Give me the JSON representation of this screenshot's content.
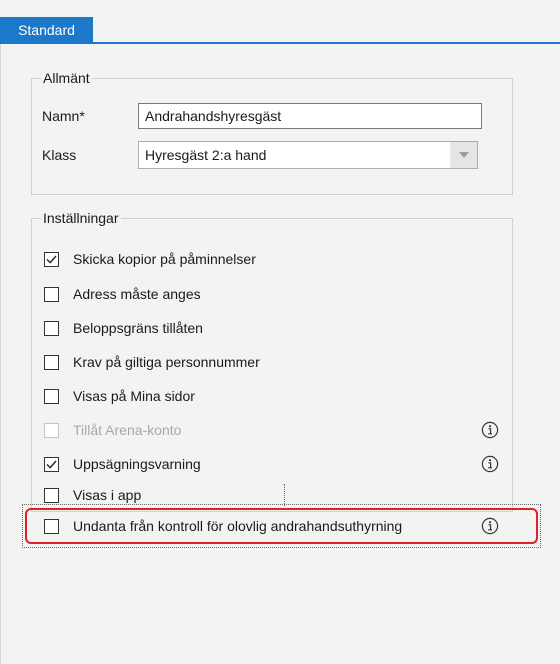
{
  "tabs": [
    {
      "label": "Standard"
    }
  ],
  "general": {
    "legend": "Allmänt",
    "name_label": "Namn*",
    "name_value": "Andrahandshyresgäst",
    "class_label": "Klass",
    "class_value": "Hyresgäst 2:a hand"
  },
  "settings": {
    "legend": "Inställningar",
    "items": [
      {
        "label": "Skicka kopior på påminnelser",
        "checked": true,
        "enabled": true,
        "info": false
      },
      {
        "label": "Adress måste anges",
        "checked": false,
        "enabled": true,
        "info": false
      },
      {
        "label": "Beloppsgräns tillåten",
        "checked": false,
        "enabled": true,
        "info": false
      },
      {
        "label": "Krav på giltiga personnummer",
        "checked": false,
        "enabled": true,
        "info": false
      },
      {
        "label": "Visas på Mina sidor",
        "checked": false,
        "enabled": true,
        "info": false
      },
      {
        "label": "Tillåt Arena-konto",
        "checked": false,
        "enabled": false,
        "info": true
      },
      {
        "label": "Uppsägningsvarning",
        "checked": true,
        "enabled": true,
        "info": true
      },
      {
        "label": "Visas i app",
        "checked": false,
        "enabled": true,
        "info": false
      },
      {
        "label": "Undanta från kontroll för olovlig andrahandsuthyrning",
        "checked": false,
        "enabled": true,
        "info": true
      }
    ]
  },
  "colors": {
    "accent": "#1c79c9",
    "highlight": "#e0202b"
  }
}
